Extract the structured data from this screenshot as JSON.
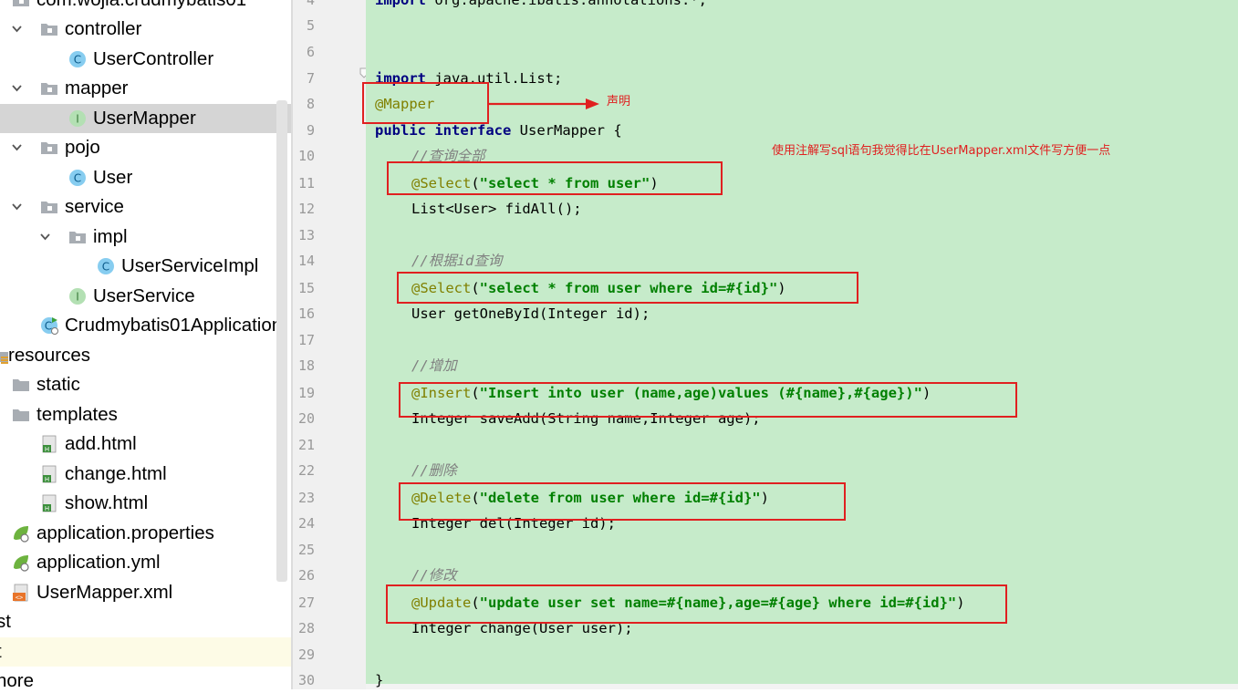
{
  "project_tree": {
    "items": [
      {
        "label": "com.wojia.crudmybatis01"
      },
      {
        "label": "controller"
      },
      {
        "label": "UserController"
      },
      {
        "label": "mapper"
      },
      {
        "label": "UserMapper"
      },
      {
        "label": "pojo"
      },
      {
        "label": "User"
      },
      {
        "label": "service"
      },
      {
        "label": "impl"
      },
      {
        "label": "UserServiceImpl"
      },
      {
        "label": "UserService"
      },
      {
        "label": "Crudmybatis01Application"
      },
      {
        "label": "resources"
      },
      {
        "label": "static"
      },
      {
        "label": "templates"
      },
      {
        "label": "add.html"
      },
      {
        "label": "change.html"
      },
      {
        "label": "show.html"
      },
      {
        "label": "application.properties"
      },
      {
        "label": "application.yml"
      },
      {
        "label": "UserMapper.xml"
      },
      {
        "label": "st"
      },
      {
        "label": "t"
      },
      {
        "label": "nore"
      }
    ],
    "selected": "UserMapper"
  },
  "editor": {
    "line_numbers": [
      "4",
      "5",
      "6",
      "7",
      "8",
      "9",
      "10",
      "11",
      "12",
      "13",
      "14",
      "15",
      "16",
      "17",
      "18",
      "19",
      "20",
      "21",
      "22",
      "23",
      "24",
      "25",
      "26",
      "27",
      "28",
      "29",
      "30"
    ],
    "lines": {
      "l4_import": "import",
      "l4_rest": " org.apache.ibatis.annotations.*;",
      "l7_import": "import",
      "l7_rest": " java.util.List;",
      "l8_annot": "@Mapper",
      "l9_public": "public",
      "l9_interface": "interface",
      "l9_rest": " UserMapper {",
      "l10_comment": "//查询全部",
      "l11_annot": "@Select",
      "l11_open": "(",
      "l11_str": "\"select * from user\"",
      "l11_close": ")",
      "l12": "List<User> fidAll();",
      "l14_comment": "//根据id查询",
      "l15_annot": "@Select",
      "l15_open": "(",
      "l15_str": "\"select * from user where id=#{id}\"",
      "l15_close": ")",
      "l16": "User getOneById(Integer id);",
      "l18_comment": "//增加",
      "l19_annot": "@Insert",
      "l19_open": "(",
      "l19_str": "\"Insert into user (name,age)values (#{name},#{age})\"",
      "l19_close": ")",
      "l20": "Integer saveAdd(String name,Integer age);",
      "l22_comment": "//删除",
      "l23_annot": "@Delete",
      "l23_open": "(",
      "l23_str": "\"delete from user where id=#{id}\"",
      "l23_close": ")",
      "l24": "Integer del(Integer id);",
      "l26_comment": "//修改",
      "l27_annot": "@Update",
      "l27_open": "(",
      "l27_str": "\"update user set name=#{name},age=#{age} where id=#{id}\"",
      "l27_close": ")",
      "l28": "Integer change(User user);",
      "l30": "}"
    }
  },
  "annotations": {
    "arrow_note": "声明",
    "side_note": "使用注解写sql语句我觉得比在UserMapper.xml文件写方便一点"
  },
  "colors": {
    "editor_bg": "#c6ebca",
    "gutter_bg": "#f0f0f0",
    "keyword": "#000080",
    "annotation": "#808000",
    "string": "#008000",
    "comment": "#808080",
    "markup_red": "#e02020",
    "selection": "#d5d5d5"
  },
  "icons": {
    "package": "package-folder-icon",
    "class": "class-icon",
    "interface": "interface-icon",
    "html": "html-file-icon",
    "spring": "spring-config-icon",
    "xml": "xml-file-icon",
    "resources": "resources-folder-icon",
    "folder": "folder-icon",
    "app": "spring-boot-app-icon"
  }
}
